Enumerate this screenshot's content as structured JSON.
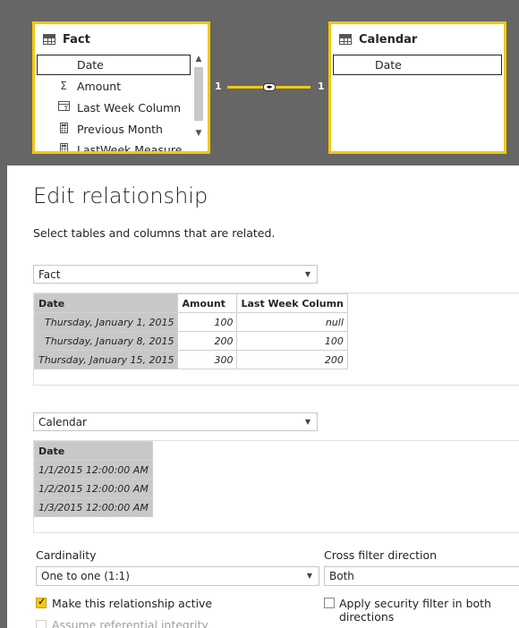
{
  "model": {
    "fact_table": {
      "title": "Fact",
      "selected_field": "Date",
      "fields": [
        {
          "label": "Amount",
          "icon": "sigma-icon"
        },
        {
          "label": "Last Week Column",
          "icon": "calculated-column-icon"
        },
        {
          "label": "Previous Month",
          "icon": "calculator-icon"
        },
        {
          "label": "LastWeek Measure",
          "icon": "calculator-icon"
        }
      ]
    },
    "calendar_table": {
      "title": "Calendar",
      "selected_field": "Date"
    },
    "relationship": {
      "left_cardinality": "1",
      "right_cardinality": "1"
    }
  },
  "dialog": {
    "title": "Edit relationship",
    "subtitle": "Select tables and columns that are related.",
    "table1": {
      "selected": "Fact",
      "headers": [
        "Date",
        "Amount",
        "Last Week Column"
      ],
      "rows": [
        [
          "Thursday, January 1, 2015",
          "100",
          "null"
        ],
        [
          "Thursday, January 8, 2015",
          "200",
          "100"
        ],
        [
          "Thursday, January 15, 2015",
          "300",
          "200"
        ]
      ]
    },
    "table2": {
      "selected": "Calendar",
      "headers": [
        "Date"
      ],
      "rows": [
        [
          "1/1/2015 12:00:00 AM"
        ],
        [
          "1/2/2015 12:00:00 AM"
        ],
        [
          "1/3/2015 12:00:00 AM"
        ]
      ]
    },
    "cardinality": {
      "label": "Cardinality",
      "value": "One to one (1:1)"
    },
    "cross_filter": {
      "label": "Cross filter direction",
      "value": "Both"
    },
    "make_active": {
      "label": "Make this relationship active",
      "checked": true
    },
    "security_filter": {
      "label": "Apply security filter in both directions",
      "checked": false
    },
    "referential_integrity": {
      "label": "Assume referential integrity",
      "checked": false,
      "disabled": true
    }
  },
  "colors": {
    "accent": "#F2C811",
    "canvas": "#666666",
    "selected_column": "#C8C8C8"
  }
}
